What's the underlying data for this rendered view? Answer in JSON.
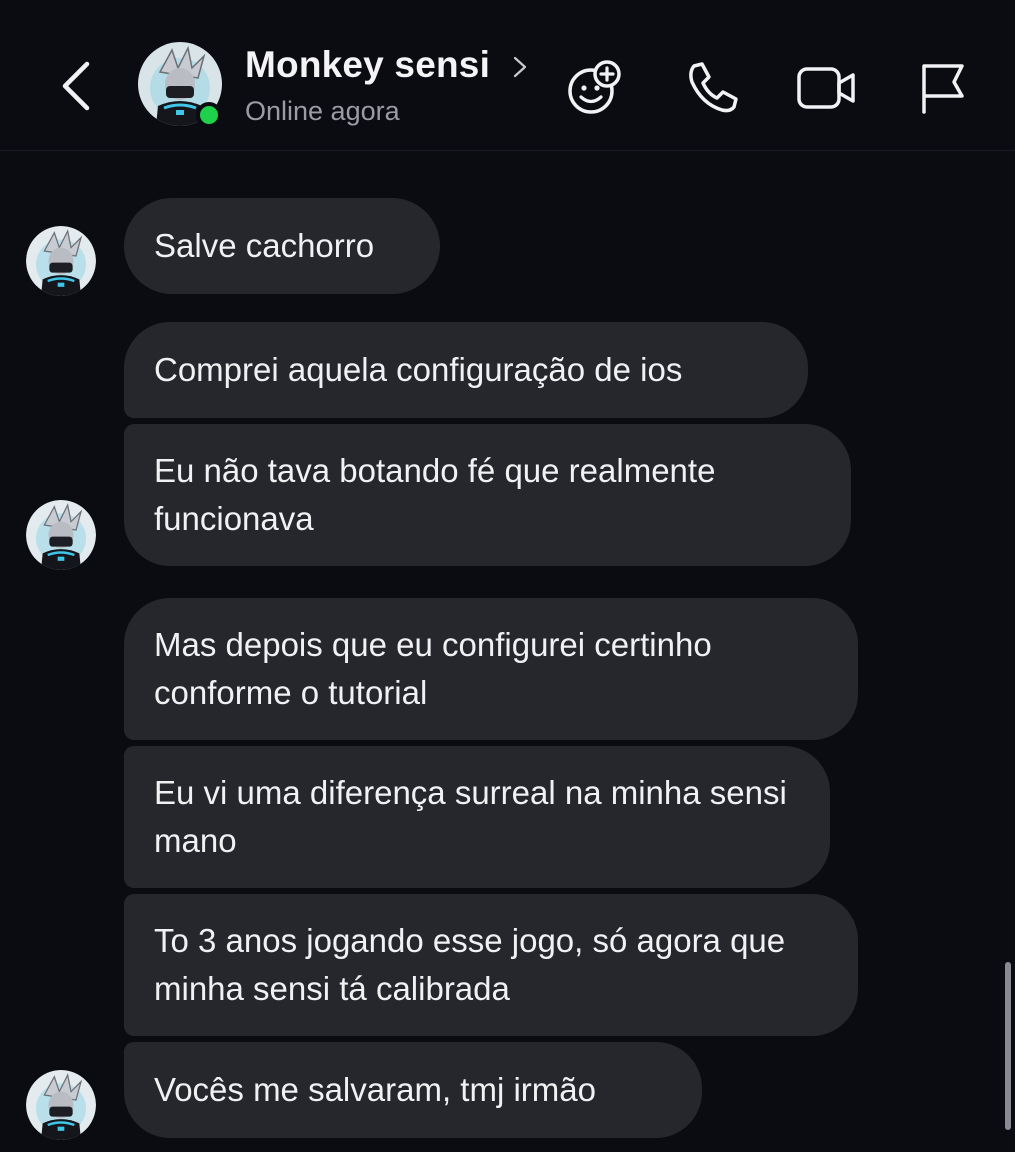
{
  "header": {
    "contact_name": "Monkey sensi",
    "status": "Online agora"
  },
  "icons": {
    "back": "back-chevron-icon",
    "stickers": "sticker-add-icon",
    "call": "phone-icon",
    "video": "video-camera-icon",
    "report": "flag-icon"
  },
  "colors": {
    "background": "#0b0c12",
    "bubble": "#26272d",
    "online": "#1fd14a",
    "secondary_text": "#9a9ba3"
  },
  "messages": [
    {
      "text": "Salve cachorro"
    },
    {
      "text": "Comprei aquela configuração de ios"
    },
    {
      "text": "Eu não tava botando fé que realmente funcionava"
    },
    {
      "text": "Mas depois que eu configurei certinho conforme o tutorial"
    },
    {
      "text": "Eu vi uma diferença surreal na minha sensi mano"
    },
    {
      "text": "To 3 anos jogando esse jogo, só agora que minha sensi tá calibrada"
    },
    {
      "text": "Vocês me salvaram, tmj irmão"
    }
  ]
}
